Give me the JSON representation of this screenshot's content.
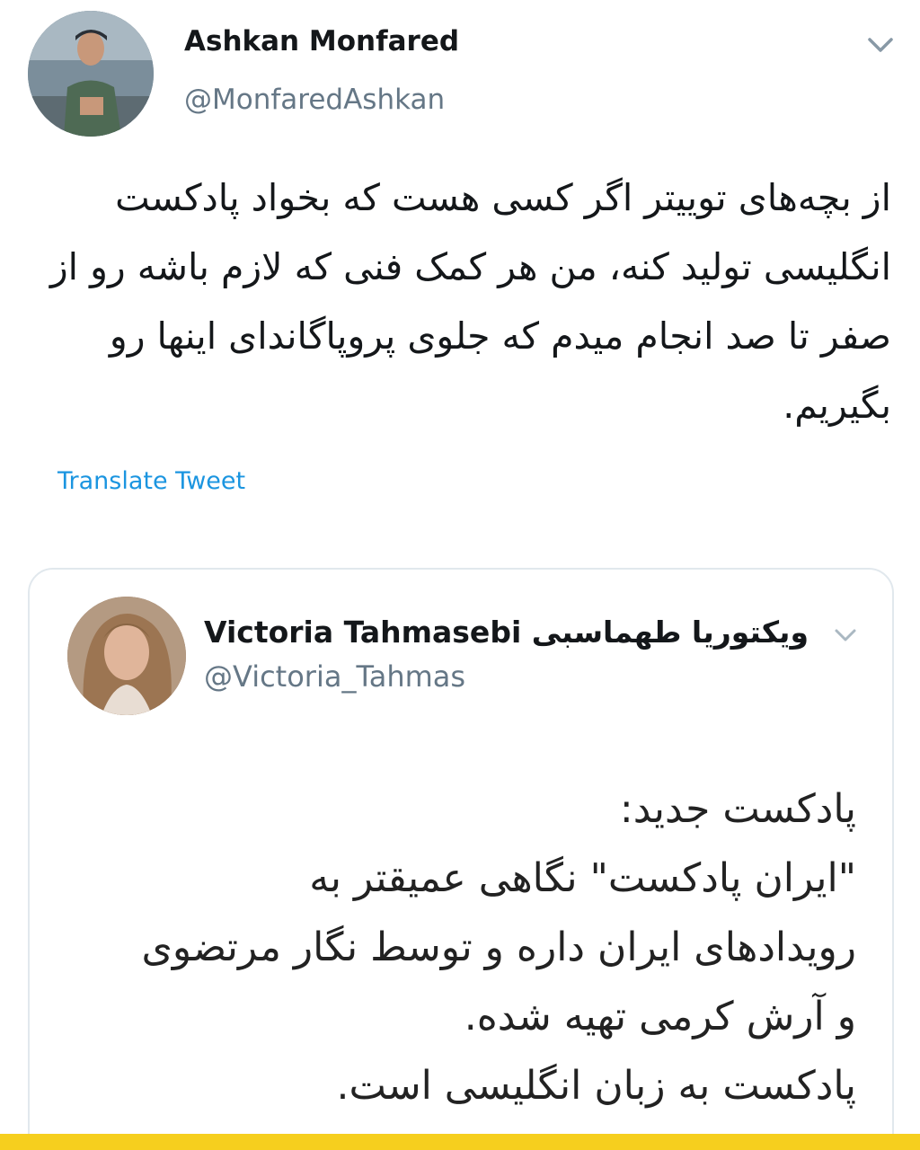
{
  "main_tweet": {
    "author_name": "Ashkan Monfared",
    "author_handle": "@MonfaredAshkan",
    "text": "از بچه‌های توییتر اگر کسی هست که بخواد پادکست انگلیسی تولید کنه، من هر کمک فنی که لازم باشه رو از صفر تا صد انجام میدم که جلوی پروپاگاندای اینها رو بگیریم.",
    "translate_label": "Translate Tweet"
  },
  "quoted_tweet": {
    "author_name": "Victoria Tahmasebi ویکتوریا طهماسبی",
    "author_handle": "@Victoria_Tahmas",
    "lines": [
      "پادکست جدید:",
      "\"ایران پادکست\" نگاهی عمیقتر به",
      "رویدادهای ایران داره و توسط نگار مرتضوی",
      "و آرش کرمی تهیه شده.",
      "پادکست به زبان انگلیسی است."
    ]
  },
  "icons": {
    "menu": "chevron-down-icon",
    "quote_menu": "chevron-down-icon"
  },
  "colors": {
    "link": "#1b95e0",
    "secondary_text": "#657786",
    "border": "#e1e8ed",
    "bottom_bar": "#f6cf1e"
  }
}
